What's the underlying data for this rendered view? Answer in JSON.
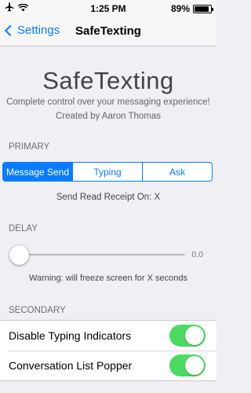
{
  "status_bar": {
    "time": "1:25 PM",
    "battery": "89%",
    "battery_level": 0.89
  },
  "nav": {
    "back_label": "Settings",
    "title": "SafeTexting"
  },
  "app": {
    "title": "SafeTexting",
    "tagline": "Complete control over your messaging experience!",
    "author": "Created by Aaron Thomas"
  },
  "primary": {
    "header": "PRIMARY",
    "segments": [
      "Message Send",
      "Typing",
      "Ask"
    ],
    "selected": "Message Send",
    "receipt_text": "Send Read Receipt On: X"
  },
  "delay": {
    "header": "DELAY",
    "value": "0.0",
    "level": 0,
    "warning": "Warning: will freeze screen for X seconds"
  },
  "secondary": {
    "header": "SECONDARY",
    "items": [
      {
        "label": "Disable Typing Indicators",
        "on": true
      },
      {
        "label": "Conversation List Popper",
        "on": true
      }
    ]
  },
  "colors": {
    "accent": "#0a7bff",
    "switch_on": "#4cd964",
    "background": "#efeff4"
  }
}
